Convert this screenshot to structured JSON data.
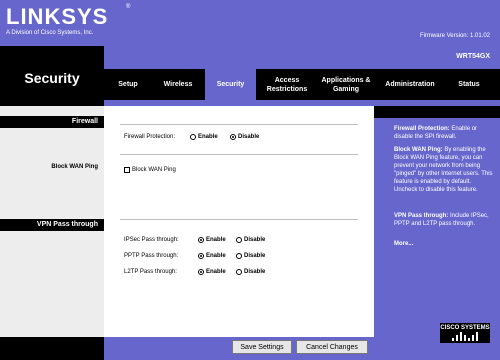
{
  "header": {
    "logo": "LINKSYS",
    "logo_reg": "®",
    "logo_subtitle": "A Division of Cisco Systems, Inc.",
    "firmware": "Firmware Version: 1.01.02",
    "model": "WRT54GX",
    "section_title": "Security"
  },
  "tabs": [
    {
      "label": "Setup",
      "active": false
    },
    {
      "label": "Wireless",
      "active": false
    },
    {
      "label": "Security",
      "active": true
    },
    {
      "label": "Access Restrictions",
      "active": false
    },
    {
      "label": "Applications & Gaming",
      "active": false
    },
    {
      "label": "Administration",
      "active": false
    },
    {
      "label": "Status",
      "active": false
    }
  ],
  "left": {
    "firewall": "Firewall",
    "block_wan": "Block WAN Ping",
    "vpn": "VPN Pass through"
  },
  "firewall": {
    "label": "Firewall Protection:",
    "enable": "Enable",
    "disable": "Disable",
    "selected": "Disable"
  },
  "block_wan": {
    "label": "Block WAN Ping",
    "checked": false
  },
  "vpn": {
    "ipsec": {
      "label": "IPSec Pass through:",
      "enable": "Enable",
      "disable": "Disable",
      "selected": "Enable"
    },
    "pptp": {
      "label": "PPTP Pass through:",
      "enable": "Enable",
      "disable": "Disable",
      "selected": "Enable"
    },
    "l2tp": {
      "label": "L2TP Pass through:",
      "enable": "Enable",
      "disable": "Disable",
      "selected": "Enable"
    }
  },
  "help": {
    "firewall_title": "Firewall Protection:",
    "firewall_text": " Enable or disable the SPI firewall.",
    "block_title": "Block WAN Ping:",
    "block_text": " By enabling the Block WAN Ping feature, you can prevent your network from being \"pinged\" by other Internet users. This feature is enabled by default. Uncheck to disable this feature.",
    "vpn_title": "VPN Pass through:",
    "vpn_text": " Include IPSec, PPTP and L2TP pass through.",
    "more": "More..."
  },
  "buttons": {
    "save": "Save Settings",
    "cancel": "Cancel Changes"
  },
  "cisco": "CISCO SYSTEMS",
  "colors": {
    "brand_purple": "#6666cc",
    "black": "#000000"
  }
}
